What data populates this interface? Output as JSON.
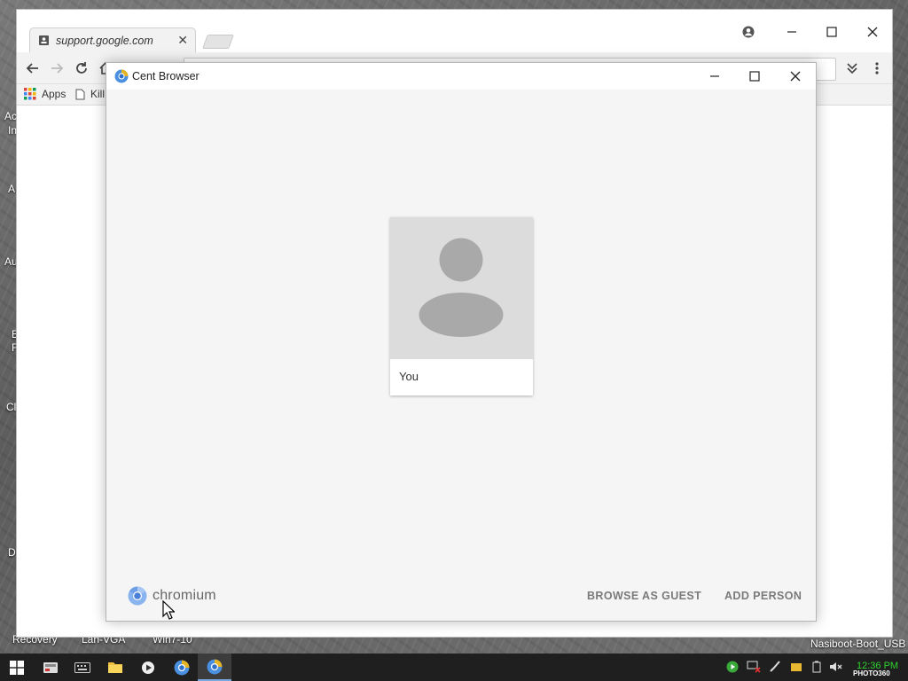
{
  "background_browser": {
    "tab_title": "support.google.com",
    "bookmarks": [
      {
        "label": "Apps"
      },
      {
        "label": "Kill"
      }
    ]
  },
  "desktop": {
    "fragments": [
      "Ac",
      "In",
      "A",
      "Au",
      "E",
      "F",
      "Cl",
      "D"
    ],
    "icon_labels": [
      "Recovery",
      "Lan-VGA",
      "Win7-10",
      "Nasiboot-Boot_USB"
    ]
  },
  "profile_picker": {
    "window_title": "Cent Browser",
    "profiles": [
      {
        "name": "You"
      }
    ],
    "brand": "chromium",
    "browse_as_guest_label": "BROWSE AS GUEST",
    "add_person_label": "ADD PERSON"
  },
  "taskbar": {
    "clock": "12:36 PM"
  },
  "watermark": "PHOTO360",
  "colors": {
    "picker_background": "#f5f5f5",
    "avatar_background": "#dcdcdc",
    "avatar_figure": "#a9a9a9",
    "button_text": "#7a7a7a",
    "clock_text": "#2fd12f"
  }
}
